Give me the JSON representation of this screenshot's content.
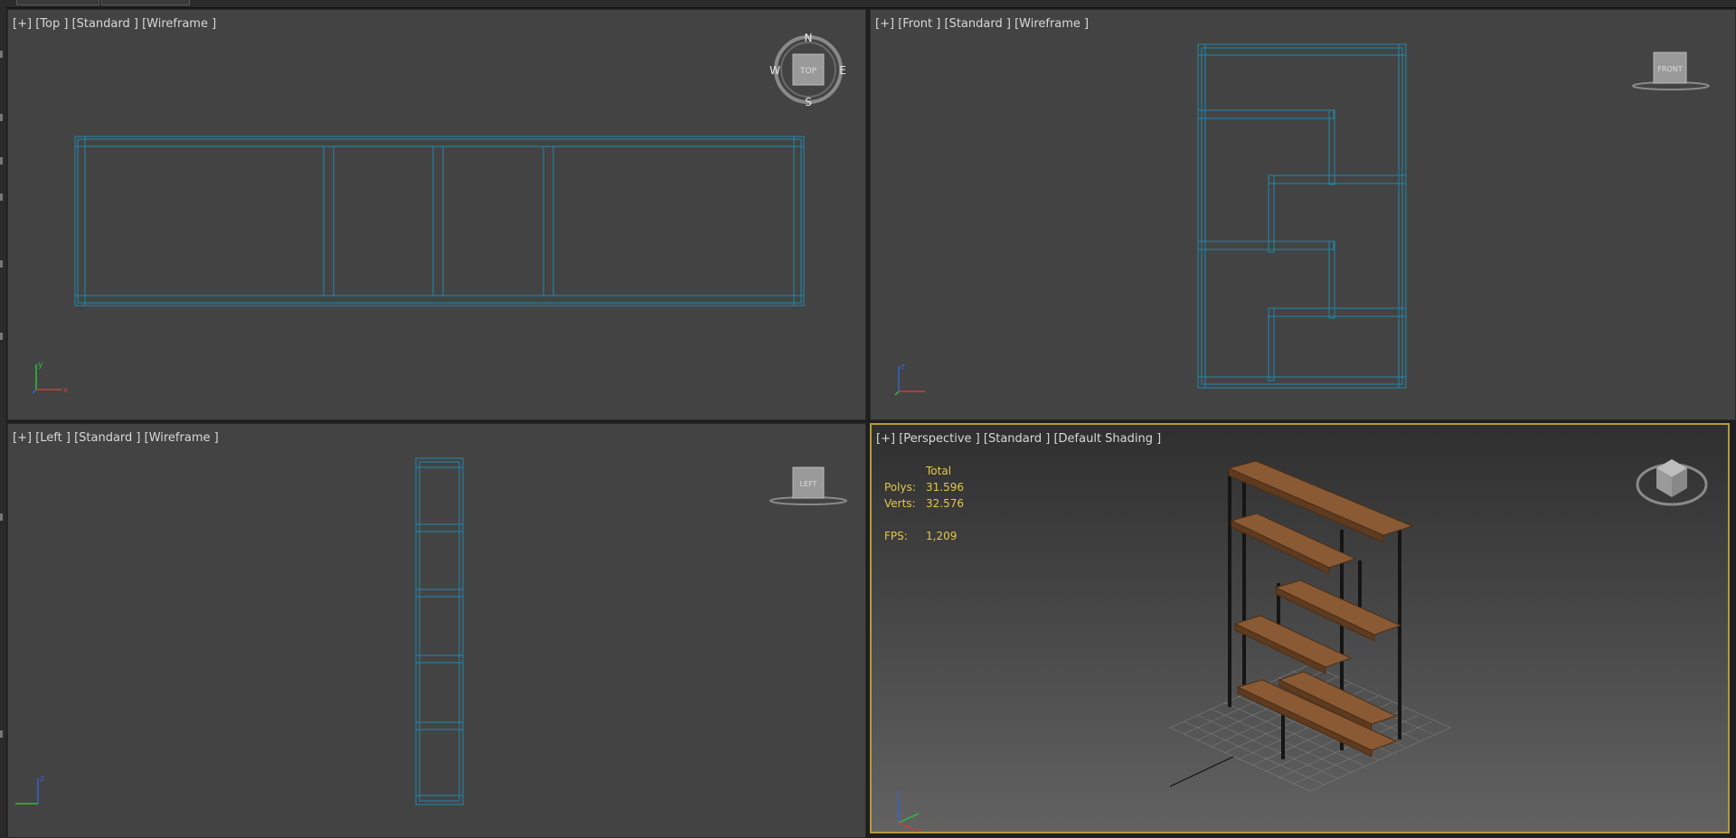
{
  "viewports": {
    "top": {
      "plus": "[+]",
      "view": "[Top ]",
      "style": "[Standard ]",
      "shading": "[Wireframe ]",
      "cube_label": "TOP",
      "compass": {
        "n": "N",
        "s": "S",
        "e": "E",
        "w": "W"
      }
    },
    "front": {
      "plus": "[+]",
      "view": "[Front ]",
      "style": "[Standard ]",
      "shading": "[Wireframe ]",
      "cube_label": "FRONT"
    },
    "left": {
      "plus": "[+]",
      "view": "[Left ]",
      "style": "[Standard ]",
      "shading": "[Wireframe ]",
      "cube_label": "LEFT"
    },
    "perspective": {
      "plus": "[+]",
      "view": "[Perspective ]",
      "style": "[Standard ]",
      "shading": "[Default Shading ]",
      "stats": {
        "header": "Total",
        "polys_label": "Polys:",
        "polys": "31.596",
        "verts_label": "Verts:",
        "verts": "32.576",
        "fps_label": "FPS:",
        "fps": "1,209"
      }
    }
  },
  "axis": {
    "x": "x",
    "y": "y",
    "z": "z"
  },
  "colors": {
    "wire": "#1f88ad",
    "active_border": "#b59a3a",
    "stats_text": "#e3c84a",
    "wood": "#8a5a34",
    "frame": "#1b1b1b"
  }
}
